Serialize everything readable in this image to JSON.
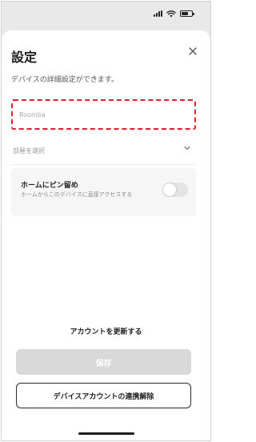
{
  "dialog": {
    "title": "設定",
    "subtitle": "デバイスの詳細設定ができます。"
  },
  "name_field": {
    "value": "",
    "placeholder": "Roomba",
    "highlight_color": "#e0202a"
  },
  "room_select": {
    "label": "部屋を選択"
  },
  "pin_home": {
    "title": "ホームにピン留め",
    "description": "ホームからこのデバイスに直接アクセスする",
    "enabled": false
  },
  "actions": {
    "update_account": "アカウントを更新する",
    "save": "保存",
    "unlink": "デバイスアカウントの連携解除"
  },
  "icons": [
    "signal-icon",
    "wifi-icon",
    "battery-icon",
    "close-icon",
    "chevron-down-icon"
  ]
}
